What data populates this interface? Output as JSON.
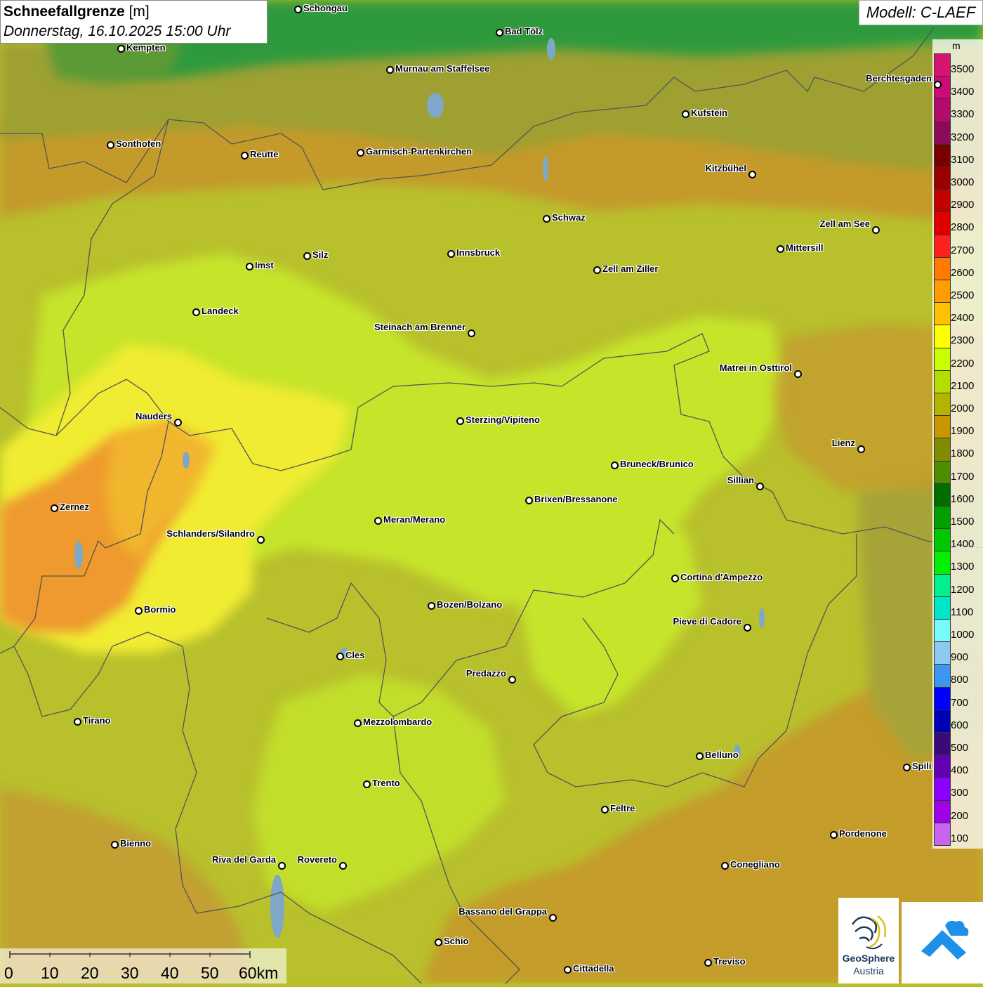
{
  "title": {
    "main": "Schneefallgrenze",
    "unit": "[m]",
    "datetime": "Donnerstag, 16.10.2025 15:00 Uhr"
  },
  "model_label": "Modell: C-LAEF",
  "legend": {
    "unit": "m",
    "entries": [
      {
        "value": "3500",
        "color": "#d4146e"
      },
      {
        "value": "3400",
        "color": "#cc0a78"
      },
      {
        "value": "3300",
        "color": "#b40a6e"
      },
      {
        "value": "3200",
        "color": "#8c0a5a"
      },
      {
        "value": "3100",
        "color": "#780000"
      },
      {
        "value": "3000",
        "color": "#9a0000"
      },
      {
        "value": "2900",
        "color": "#c40000"
      },
      {
        "value": "2800",
        "color": "#e00000"
      },
      {
        "value": "2700",
        "color": "#ff2020"
      },
      {
        "value": "2600",
        "color": "#ff7a00"
      },
      {
        "value": "2500",
        "color": "#ff9c00"
      },
      {
        "value": "2400",
        "color": "#ffc000"
      },
      {
        "value": "2300",
        "color": "#ffff00"
      },
      {
        "value": "2200",
        "color": "#c8ff00"
      },
      {
        "value": "2100",
        "color": "#b4dc00"
      },
      {
        "value": "2000",
        "color": "#b4b400"
      },
      {
        "value": "1900",
        "color": "#c89600"
      },
      {
        "value": "1800",
        "color": "#828c00"
      },
      {
        "value": "1700",
        "color": "#508c00"
      },
      {
        "value": "1600",
        "color": "#006e00"
      },
      {
        "value": "1500",
        "color": "#00a000"
      },
      {
        "value": "1400",
        "color": "#00c800"
      },
      {
        "value": "1300",
        "color": "#00f000"
      },
      {
        "value": "1200",
        "color": "#00f08c"
      },
      {
        "value": "1100",
        "color": "#00e6c8"
      },
      {
        "value": "1000",
        "color": "#78fafa"
      },
      {
        "value": "900",
        "color": "#8cc8f0"
      },
      {
        "value": "800",
        "color": "#3c96f0"
      },
      {
        "value": "700",
        "color": "#0000ff"
      },
      {
        "value": "600",
        "color": "#0000b4"
      },
      {
        "value": "500",
        "color": "#3c0a78"
      },
      {
        "value": "400",
        "color": "#6400b4"
      },
      {
        "value": "300",
        "color": "#8c00ff"
      },
      {
        "value": "200",
        "color": "#a000e6"
      },
      {
        "value": "100",
        "color": "#c864f0"
      }
    ]
  },
  "cities": [
    {
      "name": "Schongau"
    },
    {
      "name": "Bad Tölz"
    },
    {
      "name": "Kempten"
    },
    {
      "name": "Murnau am Staffelsee"
    },
    {
      "name": "Berchtesgaden"
    },
    {
      "name": "Kufstein"
    },
    {
      "name": "Sonthofen"
    },
    {
      "name": "Reutte"
    },
    {
      "name": "Garmisch-Partenkirchen"
    },
    {
      "name": "Kitzbühel"
    },
    {
      "name": "Schwaz"
    },
    {
      "name": "Zell am See"
    },
    {
      "name": "Innsbruck"
    },
    {
      "name": "Mittersill"
    },
    {
      "name": "Imst"
    },
    {
      "name": "Silz"
    },
    {
      "name": "Zell am Ziller"
    },
    {
      "name": "Landeck"
    },
    {
      "name": "Steinach am Brenner"
    },
    {
      "name": "Matrei in Osttirol"
    },
    {
      "name": "Nauders"
    },
    {
      "name": "Sterzing/Vipiteno"
    },
    {
      "name": "Lienz"
    },
    {
      "name": "Bruneck/Brunico"
    },
    {
      "name": "Sillian"
    },
    {
      "name": "Zernez"
    },
    {
      "name": "Brixen/Bressanone"
    },
    {
      "name": "Meran/Merano"
    },
    {
      "name": "Schlanders/Silandro"
    },
    {
      "name": "Cortina d'Ampezzo"
    },
    {
      "name": "Bozen/Bolzano"
    },
    {
      "name": "Bormio"
    },
    {
      "name": "Pieve di Cadore"
    },
    {
      "name": "Cles"
    },
    {
      "name": "Predazzo"
    },
    {
      "name": "Tirano"
    },
    {
      "name": "Mezzolombardo"
    },
    {
      "name": "Belluno"
    },
    {
      "name": "Spili"
    },
    {
      "name": "Trento"
    },
    {
      "name": "Feltre"
    },
    {
      "name": "Bienno"
    },
    {
      "name": "Pordenone"
    },
    {
      "name": "Riva del Garda"
    },
    {
      "name": "Rovereto"
    },
    {
      "name": "Conegliano"
    },
    {
      "name": "Bassano del Grappa"
    },
    {
      "name": "Schio"
    },
    {
      "name": "Treviso"
    },
    {
      "name": "Cittadella"
    }
  ],
  "scale_bar": {
    "labels": [
      "0",
      "10",
      "20",
      "30",
      "40",
      "50",
      "60km"
    ]
  },
  "logo": {
    "name_line1": "GeoSphere",
    "name_line2": "Austria"
  },
  "colors": {
    "green_low": "#2c9a3c",
    "olive": "#a8a630",
    "ochre": "#c69a28",
    "yellowgreen": "#bcd22a",
    "lime": "#c8ec26",
    "yellow": "#f2f030",
    "orange": "#ef9a2c"
  }
}
